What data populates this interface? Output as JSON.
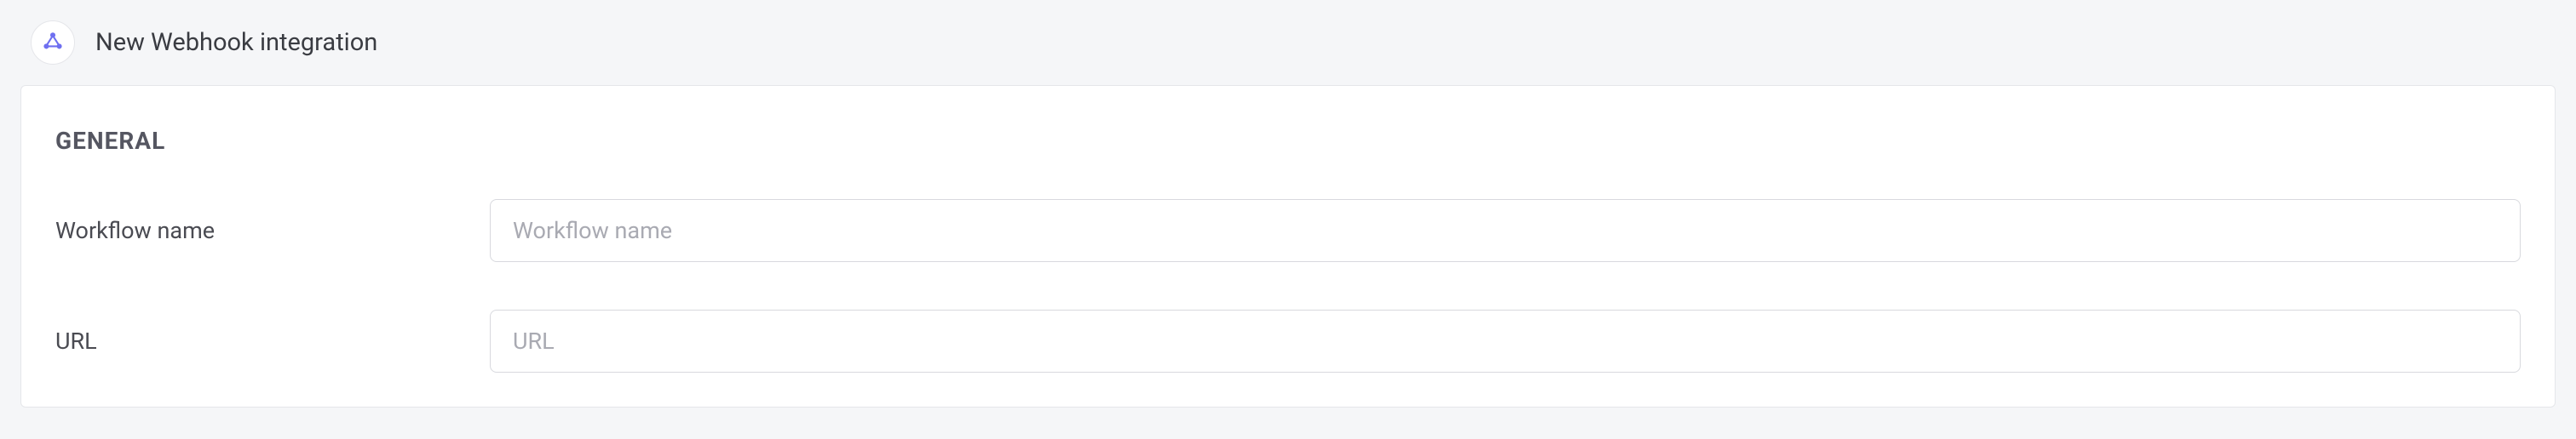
{
  "header": {
    "title": "New Webhook integration",
    "icon_name": "webhook-icon"
  },
  "section": {
    "title": "GENERAL"
  },
  "fields": {
    "workflow_name": {
      "label": "Workflow name",
      "placeholder": "Workflow name",
      "value": ""
    },
    "url": {
      "label": "URL",
      "placeholder": "URL",
      "value": ""
    }
  },
  "colors": {
    "icon_color": "#6e6ff0",
    "page_bg": "#f5f6f8",
    "card_bg": "#ffffff",
    "border": "#d8d9de"
  }
}
